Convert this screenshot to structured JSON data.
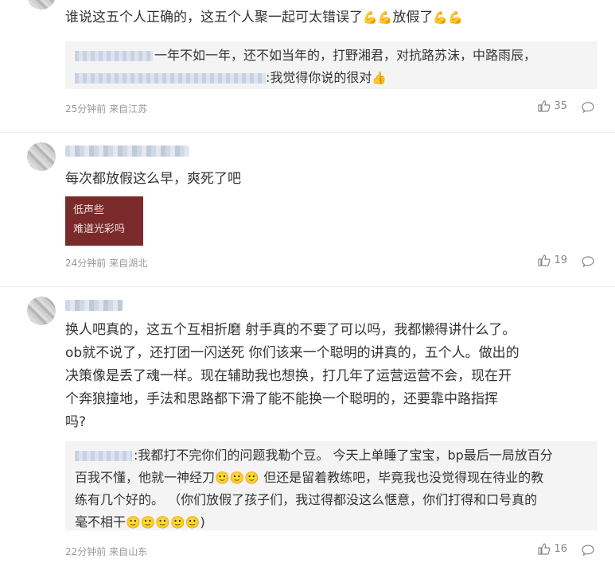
{
  "comments": [
    {
      "text": "谁说这五个人正确的，这五个人聚一起可太错误了",
      "text_tail": "放假了",
      "reply": {
        "line1": "一年不如一年，还不如当年的，打野湘君，对抗路苏沫，中路雨辰，",
        "line2": ":我觉得你说的很对"
      },
      "time": "25分钟前 来自江苏",
      "likes": "35"
    },
    {
      "text": "每次都放假这么早，爽死了吧",
      "sticker": {
        "line1": "低声些",
        "line2": "难道光彩吗"
      },
      "time": "24分钟前 来自湖北",
      "likes": "19"
    },
    {
      "text_lines": [
        "换人吧真的，这五个互相折磨 射手真的不要了可以吗，我都懒得讲什么了。",
        "ob就不说了，还打团一闪送死 你们该来一个聪明的讲真的，五个人。做出的",
        "决策像是丢了魂一样。现在辅助我也想换，打几年了运营运营不会，现在开",
        "个奔狼撞地，手法和思路都下滑了能不能换一个聪明的，还要靠中路指挥",
        "吗?"
      ],
      "reply": {
        "line1": ":我都打不完你们的问题我勒个豆。 今天上单睡了宝宝，bp最后一局放百分",
        "line2a": "百我不懂，他就一神经刀",
        "line2b": " 但还是留着教练吧，毕竟我也没觉得现在待业的教",
        "line3": "练有几个好的。  （你们放假了孩子们，我过得都没这么惬意，你们打得和口号真的",
        "line4a": "毫不相干",
        "line4b": ")"
      },
      "time": "22分钟前 来自山东",
      "likes": "16"
    }
  ],
  "icons": {
    "like": "thumbs-up-icon",
    "reply": "comment-bubble-icon",
    "flex": "flexed-biceps-emoji",
    "thumb": "thumbs-up-emoji",
    "smile": "slightly-smiling-face-emoji"
  },
  "emoji": {
    "flex": "💪",
    "thumb": "👍",
    "smile": "🙂"
  }
}
